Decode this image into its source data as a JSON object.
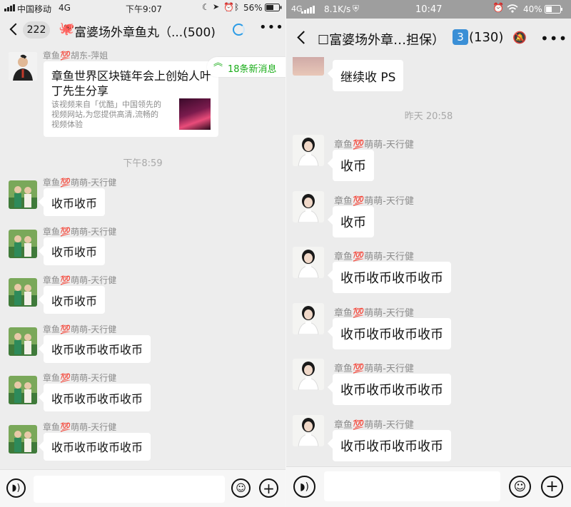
{
  "left": {
    "status": {
      "carrier": "中国移动",
      "network": "4G",
      "time": "下午9:07",
      "battery": "56%"
    },
    "nav": {
      "back_count": "222",
      "title": "富婆场外章鱼丸（...(500)"
    },
    "new_messages": "18条新消息",
    "share": {
      "sender": "章鱼💯胡东-萍姐",
      "title": "章鱼世界区块链年会上创始人叶丁先生分享",
      "desc_line1": "该视频来自「优酷」中国领先的",
      "desc_line2": "视频网站,为您提供高清,流畅的",
      "desc_line3": "视频体验"
    },
    "time_separator": "下午8:59",
    "messages": [
      {
        "sender": "章鱼💯萌萌-天行健",
        "text": "收币收币"
      },
      {
        "sender": "章鱼💯萌萌-天行健",
        "text": "收币收币"
      },
      {
        "sender": "章鱼💯萌萌-天行健",
        "text": "收币收币"
      },
      {
        "sender": "章鱼💯萌萌-天行健",
        "text": "收币收币收币收币"
      },
      {
        "sender": "章鱼💯萌萌-天行健",
        "text": "收币收币收币收币"
      },
      {
        "sender": "章鱼💯萌萌-天行健",
        "text": "收币收币收币收币"
      }
    ]
  },
  "right": {
    "status": {
      "network": "4G",
      "speed": "8.1K/s",
      "time": "10:47",
      "battery": "40%"
    },
    "nav": {
      "title": "☐富婆场外章…担保）",
      "badge": "3",
      "count": "(130)"
    },
    "prev_message": "继续收 PS",
    "time_separator": "昨天 20:58",
    "messages": [
      {
        "sender": "章鱼💯萌萌-天行健",
        "text": "收币"
      },
      {
        "sender": "章鱼💯萌萌-天行健",
        "text": "收币"
      },
      {
        "sender": "章鱼💯萌萌-天行健",
        "text": "收币收币收币收币"
      },
      {
        "sender": "章鱼💯萌萌-天行健",
        "text": "收币收币收币收币"
      },
      {
        "sender": "章鱼💯萌萌-天行健",
        "text": "收币收币收币收币"
      },
      {
        "sender": "章鱼💯萌萌-天行健",
        "text": "收币收币收币收币"
      }
    ]
  },
  "icons": [
    "signal-icon",
    "lock-rotation-icon",
    "location-icon",
    "alarm-icon",
    "bluetooth-icon",
    "battery-icon",
    "back-chevron-icon",
    "octopus-icon",
    "loading-icon",
    "more-icon",
    "double-chevron-up-icon",
    "voice-icon",
    "emoji-icon",
    "plus-icon",
    "shield-icon",
    "wifi-icon",
    "mute-bell-icon"
  ],
  "colors": {
    "chat_bg": "#ededed",
    "bubble": "#ffffff",
    "new_msg_green": "#1aad19",
    "loading_blue": "#2a9be6",
    "right_status_bar": "#9e9e9e"
  }
}
